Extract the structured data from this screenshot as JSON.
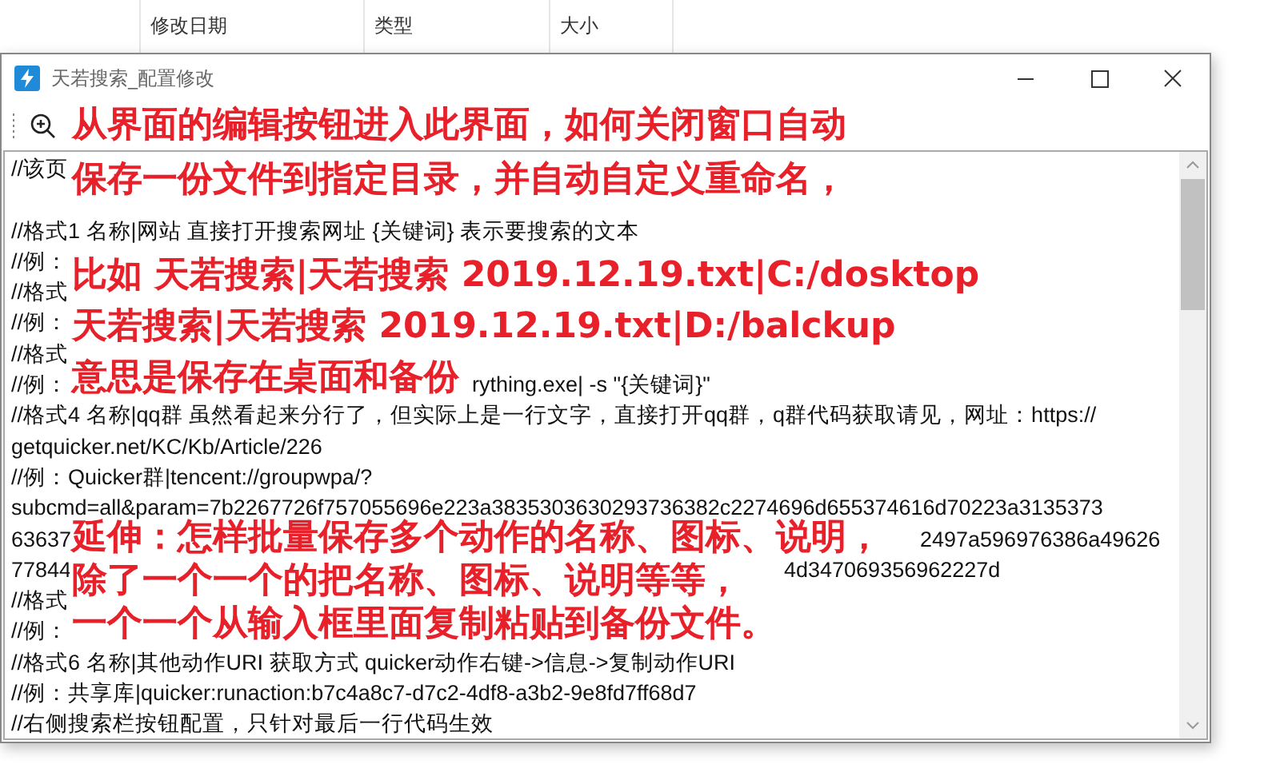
{
  "explorer_columns": [
    "修改日期",
    "类型",
    "大小"
  ],
  "window": {
    "title": "天若搜索_配置修改"
  },
  "editor_lines": [
    {
      "kind": "code",
      "text": "//该页"
    },
    {
      "kind": "blank"
    },
    {
      "text": "//格式1 名称|网站 直接打开搜索网址 {关键词} 表示要搜索的文本"
    },
    {
      "text": "//例："
    },
    {
      "text": "//格式"
    },
    {
      "text": "//例："
    },
    {
      "text": "//格式"
    },
    {
      "text": "//例：",
      "tail": "rything.exe| -s \"{关键词}\""
    },
    {
      "text": "//格式4 名称|qq群 虽然看起来分行了，但实际上是一行文字，直接打开qq群，q群代码获取请见，网址：https://"
    },
    {
      "text": "getquicker.net/KC/Kb/Article/226"
    },
    {
      "text": "//例：Quicker群|tencent://groupwpa/?"
    },
    {
      "text": "subcmd=all&param=7b2267726f757055696e223a3835303630293736382c2274696d655374616d70223a3135373"
    },
    {
      "text": "63637",
      "tail": "2497a596976386a49626"
    },
    {
      "text": "77844",
      "tail": "4d347069356962227d"
    },
    {
      "text": "//格式"
    },
    {
      "text": "//例："
    },
    {
      "text": "//格式6 名称|其他动作URI 获取方式 quicker动作右键->信息->复制动作URI"
    },
    {
      "text": "//例：共享库|quicker:runaction:b7c4a8c7-d7c2-4df8-a3b2-9e8fd7ff68d7"
    },
    {
      "text": "//右侧搜索栏按钮配置，只针对最后一行代码生效"
    }
  ],
  "annotations": [
    {
      "lines": [
        "从界面的编辑按钮进入此界面，如何关闭窗口自动",
        "保存一份文件到指定目录，并自动自定义重命名，"
      ]
    },
    {
      "lines": [
        "比如 天若搜索|天若搜索 2019.12.19.txt|C:/dosktop",
        "天若搜索|天若搜索 2019.12.19.txt|D:/balckup",
        "意思是保存在桌面和备份"
      ]
    },
    {
      "lines": [
        "延伸：怎样批量保存多个动作的名称、图标、说明，",
        "除了一个一个的把名称、图标、说明等等，",
        "一个一个从输入框里面复制粘贴到备份文件。"
      ]
    }
  ]
}
